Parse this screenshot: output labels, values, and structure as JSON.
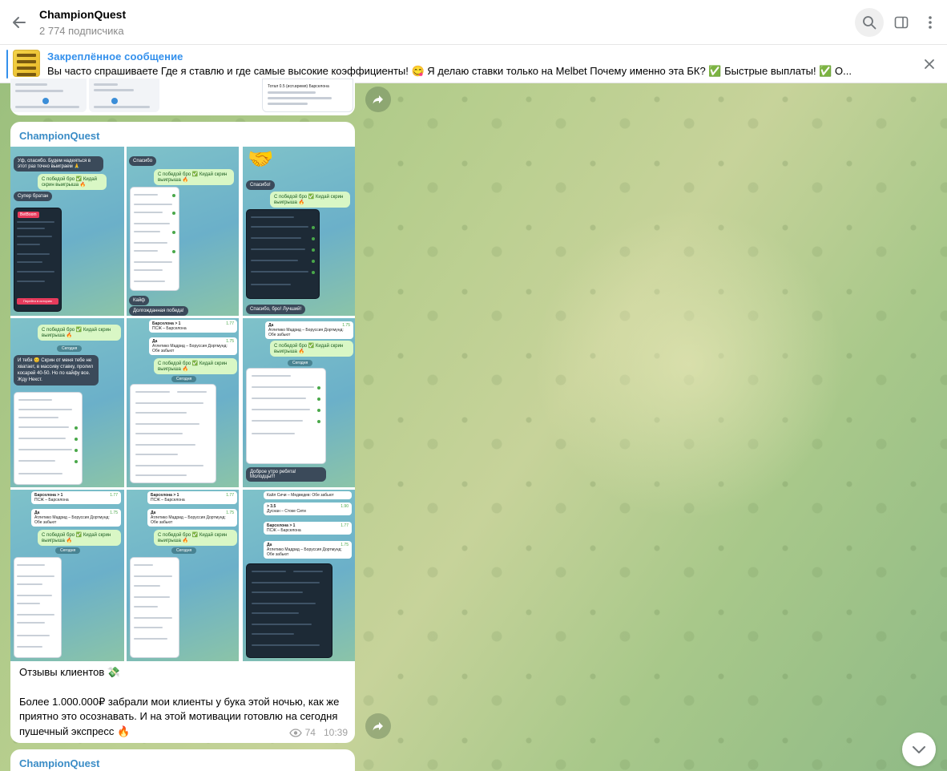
{
  "channel": {
    "title": "ChampionQuest",
    "subscribers": "2 774 подписчика"
  },
  "pinned": {
    "label": "Закреплённое сообщение",
    "text": "Вы часто спрашиваете   Где я ставлю и где самые высокие коэффициенты! 😋   Я делаю ставки только на  Melbet   Почему именно эта БК?  ✅ Быстрые выплаты!  ✅ О..."
  },
  "post": {
    "sender": "ChampionQuest",
    "lines": [
      "Отзывы клиентов 💸",
      "Более 1.000.000₽ забрали мои клиенты у бука этой ночью, как же приятно это осознавать. И на этой мотивации готовлю на сегодня пушечный экспресс 🔥"
    ],
    "views": "74",
    "time": "10:39",
    "screens": {
      "t1": {
        "in1": "Уф, спасибо. Будем надеяться в этот раз точно выиграем 🙏",
        "out1": "С победой бро ✅ Кидай скрин выигрыша 🔥",
        "in2": "Супер братан",
        "badge": "BetBoom",
        "btn": "Перейти в историю"
      },
      "t2": {
        "in1": "Спасибо",
        "out1": "С победой бро ✅ Кидай скрин выигрыша 🔥",
        "in2": "Кайф",
        "in3": "Долгожданная победа!"
      },
      "t3": {
        "in1": "Спасибо!",
        "out1": "С победой бро ✅ Кидай скрин выигрыша 🔥",
        "in2": "Спасибо, бро! Лучший!"
      },
      "t4": {
        "out1": "С победой бро ✅ Кидай скрин выигрыша 🔥",
        "date": "Сегодня",
        "in1": "И тебя 😊 Скрин от меня тебе не хватает, в массиву ставку, пролил косарей 40-50. Но по кайфу все. Жду Некст."
      },
      "t5": {
        "card1": "Барселона > 1",
        "card1b": "ПСЖ – Барселона",
        "card1v": "1.77",
        "card2": "Да",
        "card2b": "Атлетико Мадрид – Боруссия Дортмунд: Обе забьют",
        "card2v": "1.75",
        "out1": "С победой бро ✅ Кидай скрин выигрыша 🔥",
        "date": "Сегодня"
      },
      "t6": {
        "card1": "Да",
        "card1b": "Атлетико Мадрид – Боруссия Дортмунд: Обе забьют",
        "card1v": "1.75",
        "out1": "С победой бро ✅ Кидай скрин выигрыша 🔥",
        "date": "Сегодня",
        "in1": "Доброе утро ребята! Молодцы!!!"
      },
      "t7": {
        "card1": "Барселона > 1",
        "card1b": "ПСЖ – Барселона",
        "card1v": "1.77",
        "card2": "Да",
        "card2b": "Атлетико Мадрид – Боруссия Дортмунд: Обе забьют",
        "card2v": "1.75",
        "out1": "С победой бро ✅ Кидай скрин выигрыша 🔥",
        "date": "Сегодня"
      },
      "t8": {
        "card1": "Барселона > 1",
        "card1b": "ПСЖ – Барселона",
        "card1v": "1.77",
        "card2": "Да",
        "card2b": "Атлетико Мадрид – Боруссия Дортмунд: Обе забьют",
        "card2v": "1.75",
        "out1": "С победой бро ✅ Кидай скрин выигрыша 🔥",
        "date": "Сегодня"
      },
      "t9": {
        "card1": "Кайл Сичи – Медведев: Обе забьют",
        "card2": "> 3.5",
        "card2b": "Дуснан – Стоке Сити",
        "card2v": "1.90",
        "card3": "Барселона > 1",
        "card3b": "ПСЖ – Барселона",
        "card3v": "1.77",
        "card4": "Да",
        "card4b": "Атлетико Мадрид – Боруссия Дортмунд: Обе забьют",
        "card4v": "1.75"
      }
    }
  },
  "prev_post": {
    "label": "Тотал 0.5 (исп.время) Барселона"
  },
  "next_post": {
    "sender": "ChampionQuest"
  },
  "colors": {
    "accent": "#3390ec",
    "sender": "#3a8cc6",
    "meta": "#a0a0a0"
  },
  "icons": [
    "arrow-left-icon",
    "search-icon",
    "sidebar-icon",
    "more-vertical-icon",
    "close-icon",
    "share-icon",
    "chevron-down-icon",
    "eye-icon"
  ]
}
